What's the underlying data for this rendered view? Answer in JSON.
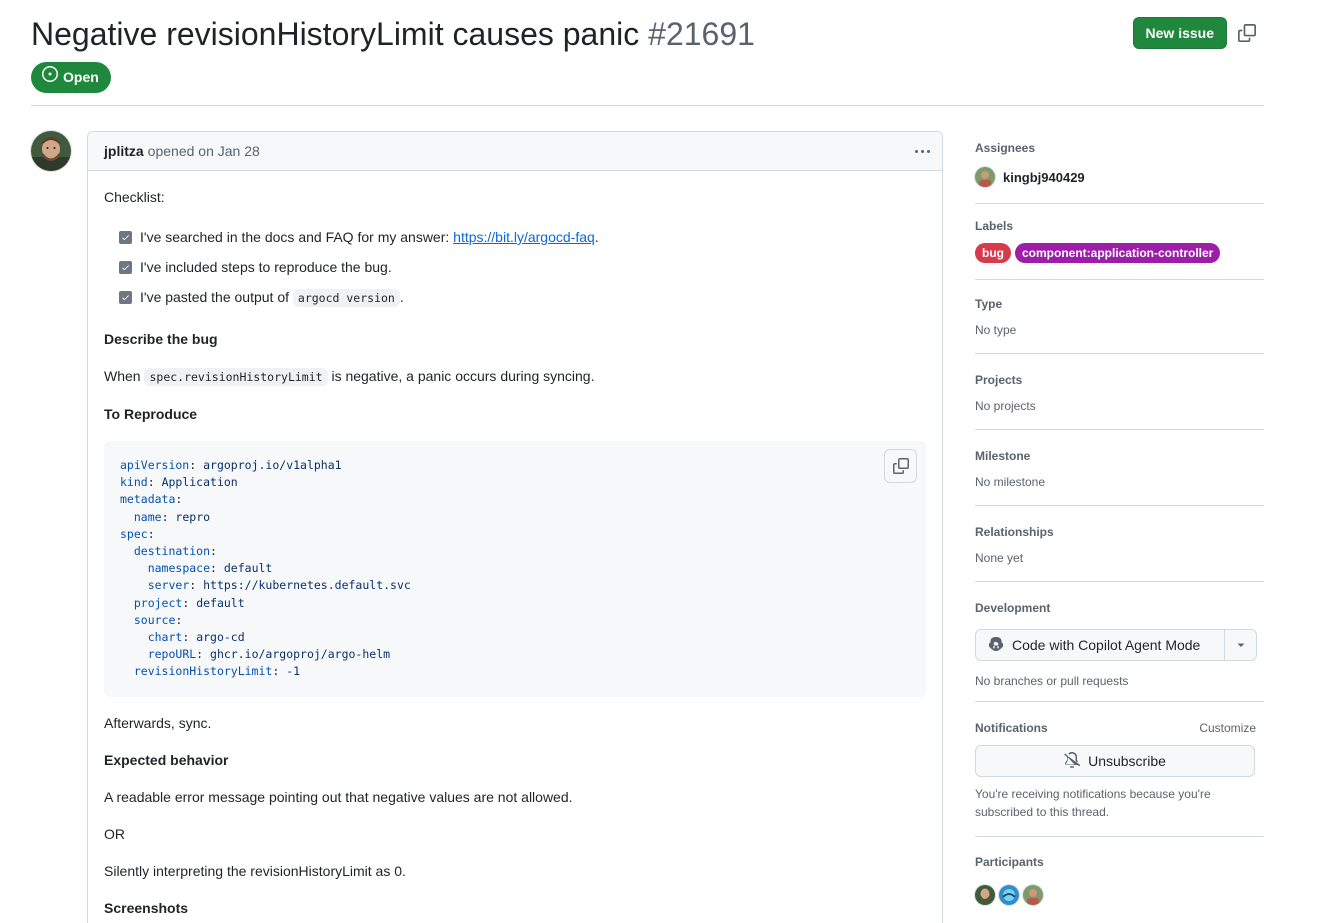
{
  "issue": {
    "title": "Negative revisionHistoryLimit causes panic",
    "number": "#21691",
    "state": "Open",
    "new_issue_label": "New issue"
  },
  "comment": {
    "author": "jplitza",
    "opened": "opened on Jan 28",
    "checklist_heading": "Checklist:",
    "tasks": [
      {
        "pre": "I've searched in the docs and FAQ for my answer: ",
        "link": "https://bit.ly/argocd-faq",
        "post": "."
      },
      {
        "pre": "I've included steps to reproduce the bug.",
        "link": "",
        "post": ""
      },
      {
        "pre": "I've pasted the output of ",
        "code": "argocd version",
        "post": "."
      }
    ],
    "describe_heading": "Describe the bug",
    "describe_pre": "When ",
    "describe_code": "spec.revisionHistoryLimit",
    "describe_post": " is negative, a panic occurs during syncing.",
    "reproduce_heading": "To Reproduce",
    "code_lines": [
      {
        "indent": "",
        "key": "apiVersion",
        "val": " argoproj.io/v1alpha1"
      },
      {
        "indent": "",
        "key": "kind",
        "val": " Application"
      },
      {
        "indent": "",
        "key": "metadata",
        "val": ""
      },
      {
        "indent": "  ",
        "key": "name",
        "val": " repro"
      },
      {
        "indent": "",
        "key": "spec",
        "val": ""
      },
      {
        "indent": "  ",
        "key": "destination",
        "val": ""
      },
      {
        "indent": "    ",
        "key": "namespace",
        "val": " default"
      },
      {
        "indent": "    ",
        "key": "server",
        "val": " https://kubernetes.default.svc"
      },
      {
        "indent": "  ",
        "key": "project",
        "val": " default"
      },
      {
        "indent": "  ",
        "key": "source",
        "val": ""
      },
      {
        "indent": "    ",
        "key": "chart",
        "val": " argo-cd"
      },
      {
        "indent": "    ",
        "key": "repoURL",
        "val": " ghcr.io/argoproj/argo-helm"
      },
      {
        "indent": "  ",
        "key": "revisionHistoryLimit",
        "val": " -1"
      }
    ],
    "afterwards": "Afterwards, sync.",
    "expected_heading": "Expected behavior",
    "expected_1": "A readable error message pointing out that negative values are not allowed.",
    "or_text": "OR",
    "expected_2": "Silently interpreting the revisionHistoryLimit as 0.",
    "screenshots_heading": "Screenshots"
  },
  "sidebar": {
    "assignees_title": "Assignees",
    "assignee": "kingbj940429",
    "labels_title": "Labels",
    "labels": [
      {
        "name": "bug",
        "color": "#d73a4a"
      },
      {
        "name": "component:application-controller",
        "color": "#9c1ea8"
      }
    ],
    "type_title": "Type",
    "type_value": "No type",
    "projects_title": "Projects",
    "projects_value": "No projects",
    "milestone_title": "Milestone",
    "milestone_value": "No milestone",
    "relationships_title": "Relationships",
    "relationships_value": "None yet",
    "development_title": "Development",
    "copilot_button": "Code with Copilot Agent Mode",
    "development_value": "No branches or pull requests",
    "notifications_title": "Notifications",
    "customize_label": "Customize",
    "unsubscribe_label": "Unsubscribe",
    "notifications_note_1": "You're receiving notifications because you're",
    "notifications_note_2": "subscribed to this thread.",
    "participants_title": "Participants"
  },
  "colors": {
    "primary_green": "#1f883d",
    "link_blue": "#0969da",
    "muted": "#59636e"
  }
}
